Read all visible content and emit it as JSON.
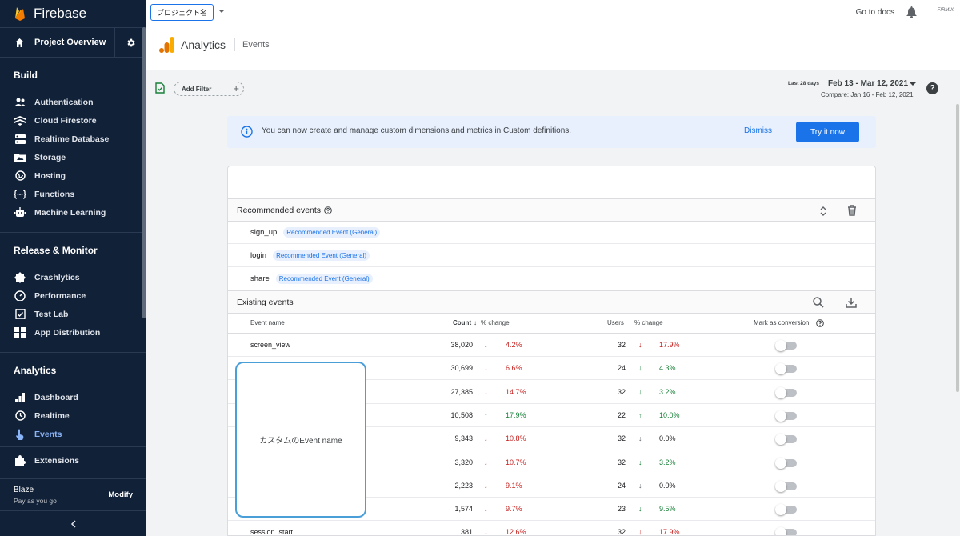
{
  "sidebar": {
    "brand": "Firebase",
    "overview": "Project Overview",
    "sections": [
      {
        "title": "Build",
        "items": [
          {
            "label": "Authentication",
            "icon": "people-icon"
          },
          {
            "label": "Cloud Firestore",
            "icon": "firestore-icon"
          },
          {
            "label": "Realtime Database",
            "icon": "database-icon"
          },
          {
            "label": "Storage",
            "icon": "storage-icon"
          },
          {
            "label": "Hosting",
            "icon": "globe-icon"
          },
          {
            "label": "Functions",
            "icon": "functions-icon"
          },
          {
            "label": "Machine Learning",
            "icon": "robot-icon"
          }
        ]
      },
      {
        "title": "Release & Monitor",
        "items": [
          {
            "label": "Crashlytics",
            "icon": "crashlytics-icon"
          },
          {
            "label": "Performance",
            "icon": "speedometer-icon"
          },
          {
            "label": "Test Lab",
            "icon": "testlab-icon"
          },
          {
            "label": "App Distribution",
            "icon": "distribution-icon"
          }
        ]
      },
      {
        "title": "Analytics",
        "items": [
          {
            "label": "Dashboard",
            "icon": "bar-chart-icon"
          },
          {
            "label": "Realtime",
            "icon": "clock-icon"
          },
          {
            "label": "Events",
            "icon": "touch-icon",
            "active": true
          }
        ]
      }
    ],
    "extensions": "Extensions",
    "plan": {
      "name": "Blaze",
      "sub": "Pay as you go",
      "modify": "Modify"
    }
  },
  "header": {
    "project": "プロジェクト名",
    "docs": "Go to docs",
    "logo_text": "FIRMIX",
    "app": "Analytics",
    "page": "Events"
  },
  "toolbar": {
    "add_filter": "Add Filter",
    "date_label": "Last 28 days",
    "date_range": "Feb 13 - Mar 12, 2021",
    "compare": "Compare: Jan 16 - Feb 12, 2021"
  },
  "banner": {
    "message": "You can now create and manage custom dimensions and metrics in Custom definitions.",
    "dismiss": "Dismiss",
    "try": "Try it now"
  },
  "recommended": {
    "title": "Recommended events",
    "items": [
      {
        "name": "sign_up",
        "tag": "Recommended Event (General)"
      },
      {
        "name": "login",
        "tag": "Recommended Event (General)"
      },
      {
        "name": "share",
        "tag": "Recommended Event (General)"
      }
    ]
  },
  "existing": {
    "title": "Existing events",
    "columns": {
      "name": "Event name",
      "count": "Count",
      "count_change": "% change",
      "users": "Users",
      "users_change": "% change",
      "conversion": "Mark as conversion"
    },
    "rows": [
      {
        "name": "screen_view",
        "count": "38,020",
        "cdir": "down",
        "cchg": "4.2%",
        "users": "32",
        "udir": "down",
        "uchg": "17.9%"
      },
      {
        "name": "",
        "count": "30,699",
        "cdir": "down",
        "cchg": "6.6%",
        "users": "24",
        "udir": "up-green-down",
        "uchg": "4.3%"
      },
      {
        "name": "",
        "count": "27,385",
        "cdir": "down",
        "cchg": "14.7%",
        "users": "32",
        "udir": "up-green-down",
        "uchg": "3.2%"
      },
      {
        "name": "",
        "count": "10,508",
        "cdir": "up",
        "cchg": "17.9%",
        "users": "22",
        "udir": "up",
        "uchg": "10.0%"
      },
      {
        "name": "",
        "count": "9,343",
        "cdir": "down",
        "cchg": "10.8%",
        "users": "32",
        "udir": "flat",
        "uchg": "0.0%"
      },
      {
        "name": "",
        "count": "3,320",
        "cdir": "down",
        "cchg": "10.7%",
        "users": "32",
        "udir": "up-green-down",
        "uchg": "3.2%"
      },
      {
        "name": "",
        "count": "2,223",
        "cdir": "down",
        "cchg": "9.1%",
        "users": "24",
        "udir": "flat",
        "uchg": "0.0%"
      },
      {
        "name": "",
        "count": "1,574",
        "cdir": "down",
        "cchg": "9.7%",
        "users": "23",
        "udir": "up-green-down",
        "uchg": "9.5%"
      },
      {
        "name": "session_start",
        "count": "381",
        "cdir": "down",
        "cchg": "12.6%",
        "users": "32",
        "udir": "down",
        "uchg": "17.9%"
      }
    ],
    "overlay": "カスタムのEvent name"
  },
  "colors": {
    "sidebar": "#112138",
    "accent": "#1a73e8",
    "down": "#c5221f",
    "up": "#188038"
  }
}
